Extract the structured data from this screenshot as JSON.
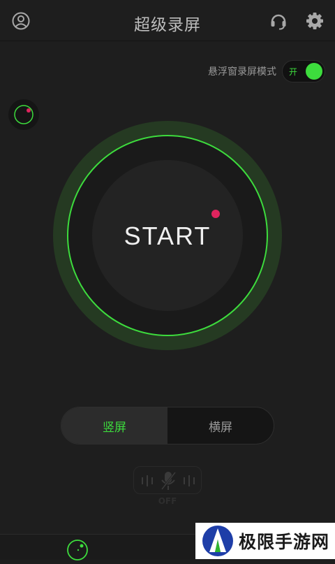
{
  "header": {
    "title": "超级录屏",
    "icons": [
      "user-icon",
      "headset-icon",
      "gear-icon"
    ]
  },
  "floating_mode": {
    "label": "悬浮窗录屏模式",
    "toggle_text": "开",
    "enabled": true
  },
  "start_button": {
    "label": "START"
  },
  "orientation": {
    "options": [
      "竖屏",
      "横屏"
    ],
    "selected": "竖屏"
  },
  "mic": {
    "state_label": "OFF"
  },
  "watermark": {
    "text": "极限手游网"
  },
  "colors": {
    "accent": "#3ddc3d",
    "record_dot": "#e0245e",
    "background": "#1e1e1e"
  }
}
